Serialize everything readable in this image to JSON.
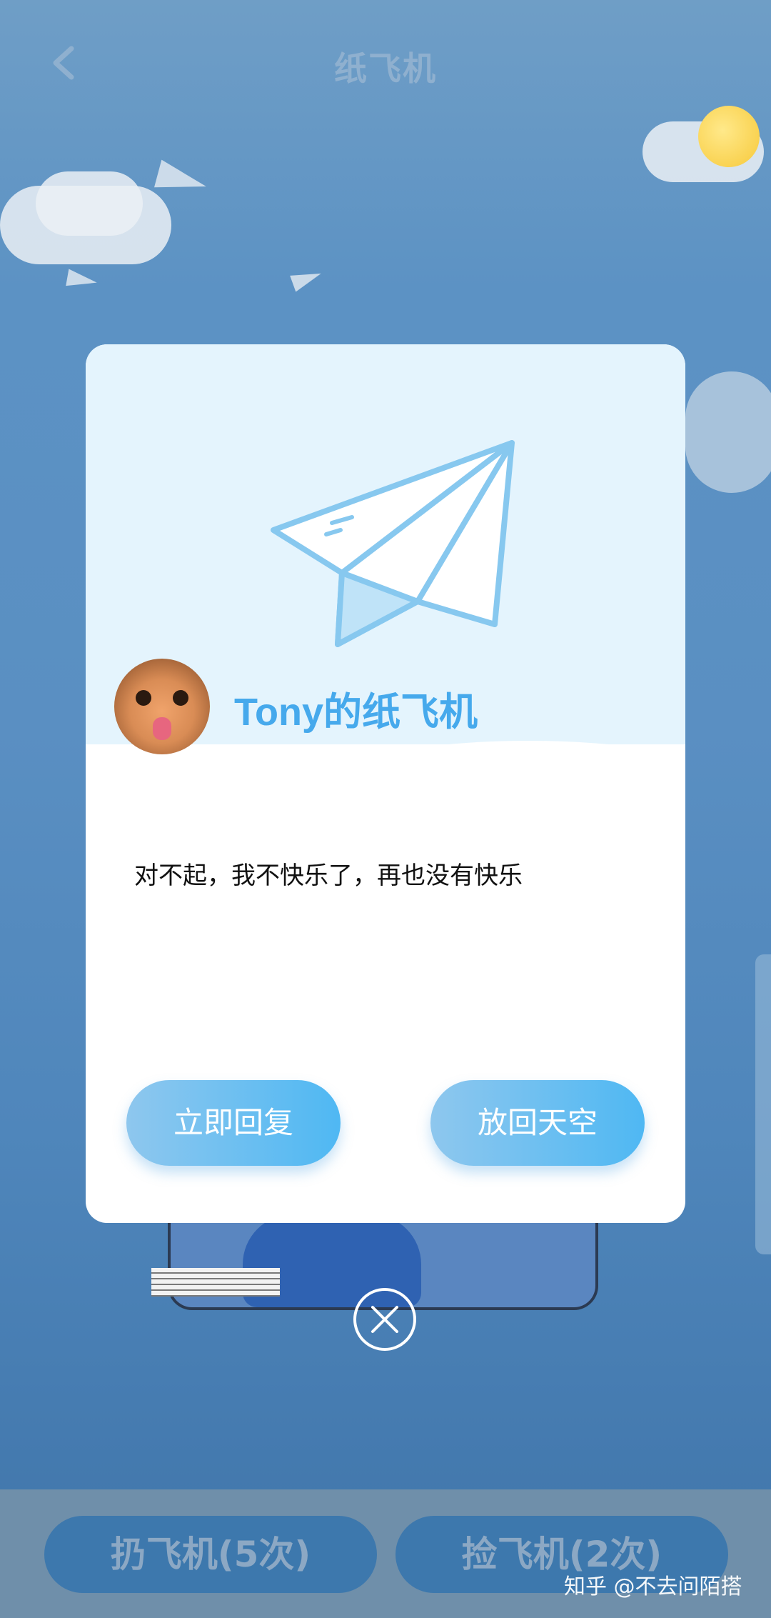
{
  "header": {
    "title": "纸飞机"
  },
  "card": {
    "plane_name": "Tony的纸飞机",
    "message": "对不起，我不快乐了，再也没有快乐",
    "reply_button": "立即回复",
    "return_button": "放回天空"
  },
  "bottom": {
    "throw_button": "扔飞机(5次)",
    "pick_button": "捡飞机(2次)"
  },
  "watermark": "知乎 @不去问陌搭",
  "colors": {
    "accent": "#46a9ec",
    "button_gradient_start": "#8ec7ee",
    "button_gradient_end": "#4fb8f3"
  }
}
